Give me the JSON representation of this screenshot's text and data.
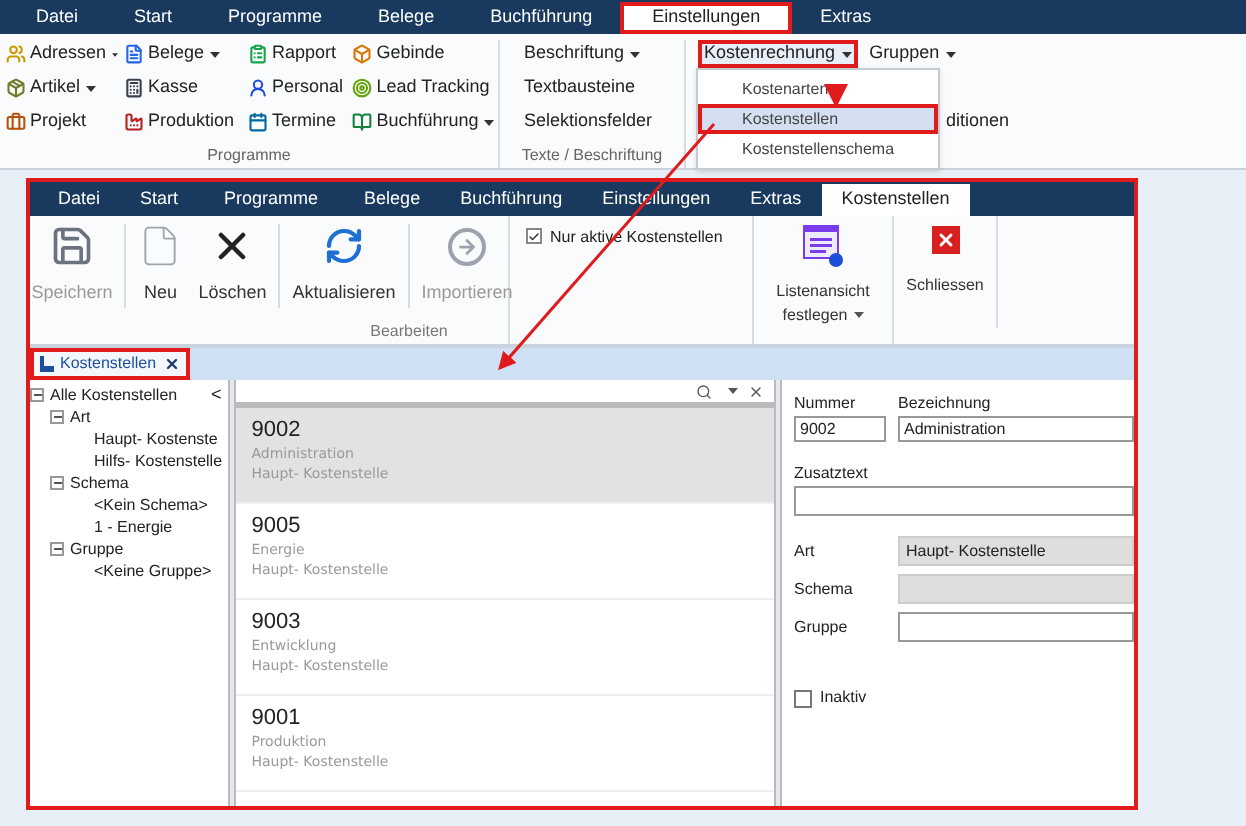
{
  "top_tabs": [
    {
      "label": "Datei",
      "selected": false,
      "highlighted": false
    },
    {
      "label": "Start",
      "selected": false,
      "highlighted": false
    },
    {
      "label": "Programme",
      "selected": false,
      "highlighted": false
    },
    {
      "label": "Belege",
      "selected": false,
      "highlighted": false
    },
    {
      "label": "Buchführung",
      "selected": false,
      "highlighted": false
    },
    {
      "label": "Einstellungen",
      "selected": true,
      "highlighted": true
    },
    {
      "label": "Extras",
      "selected": false,
      "highlighted": false
    }
  ],
  "top_ribbon": {
    "programs_group": {
      "label": "Programme",
      "columns": [
        [
          {
            "label": "Adressen",
            "dropdown": true
          },
          {
            "label": "Artikel",
            "dropdown": true
          },
          {
            "label": "Projekt",
            "dropdown": false
          }
        ],
        [
          {
            "label": "Belege",
            "dropdown": true
          },
          {
            "label": "Kasse",
            "dropdown": false
          },
          {
            "label": "Produktion",
            "dropdown": false
          }
        ],
        [
          {
            "label": "Rapport",
            "dropdown": false
          },
          {
            "label": "Personal",
            "dropdown": false
          },
          {
            "label": "Termine",
            "dropdown": false
          }
        ],
        [
          {
            "label": "Gebinde",
            "dropdown": false
          },
          {
            "label": "Lead Tracking",
            "dropdown": false
          },
          {
            "label": "Buchführung",
            "dropdown": true
          }
        ]
      ]
    },
    "texts_group": {
      "label": "Texte / Beschriftung",
      "items": [
        {
          "label": "Beschriftung",
          "dropdown": true
        },
        {
          "label": "Textbausteine",
          "dropdown": false
        },
        {
          "label": "Selektionsfelder",
          "dropdown": false
        }
      ]
    },
    "cost_group": {
      "items": [
        {
          "label": "Kostenrechnung",
          "dropdown": true,
          "highlighted": true
        },
        {
          "label": "Gruppen",
          "dropdown": true,
          "highlighted": false
        }
      ],
      "partial_item": "ditionen"
    }
  },
  "dropdown_menu": {
    "items": [
      {
        "label": "Kostenarten",
        "selected": false,
        "highlighted": false
      },
      {
        "label": "Kostenstellen",
        "selected": true,
        "highlighted": true
      },
      {
        "label": "Kostenstellenschema",
        "selected": false,
        "highlighted": false
      }
    ]
  },
  "inner_window": {
    "highlighted": true,
    "tabs": [
      {
        "label": "Datei",
        "selected": false
      },
      {
        "label": "Start",
        "selected": false
      },
      {
        "label": "Programme",
        "selected": false
      },
      {
        "label": "Belege",
        "selected": false
      },
      {
        "label": "Buchführung",
        "selected": false
      },
      {
        "label": "Einstellungen",
        "selected": false
      },
      {
        "label": "Extras",
        "selected": false
      },
      {
        "label": "Kostenstellen",
        "selected": true
      }
    ],
    "ribbon": {
      "buttons": [
        {
          "label": "Speichern",
          "disabled": true
        },
        {
          "label": "Neu",
          "disabled": false
        },
        {
          "label": "Löschen",
          "disabled": false
        },
        {
          "label": "Aktualisieren",
          "disabled": false
        },
        {
          "label": "Importieren",
          "disabled": true
        }
      ],
      "group_label": "Bearbeiten",
      "checkbox": {
        "label": "Nur aktive Kostenstellen",
        "checked": true
      },
      "list_view": {
        "lines": [
          "Listenansicht",
          "festlegen"
        ],
        "dropdown": true
      },
      "close": {
        "label": "Schliessen"
      }
    },
    "doc_tab": {
      "label": "Kostenstellen",
      "highlighted": true
    },
    "tree": [
      {
        "label": "Alle Kostenstellen",
        "expanded": true,
        "children": [
          {
            "label": "Art",
            "expanded": true,
            "children": [
              {
                "label": "Haupt- Kostenste"
              },
              {
                "label": "Hilfs- Kostenstelle"
              }
            ]
          },
          {
            "label": "Schema",
            "expanded": true,
            "children": [
              {
                "label": "<Kein Schema>"
              },
              {
                "label": "1 - Energie"
              }
            ]
          },
          {
            "label": "Gruppe",
            "expanded": true,
            "children": [
              {
                "label": "<Keine Gruppe>"
              }
            ]
          }
        ]
      }
    ],
    "tree_collapse": "<",
    "list": [
      {
        "number": "9002",
        "name": "Administration",
        "type": "Haupt- Kostenstelle",
        "selected": true
      },
      {
        "number": "9005",
        "name": "Energie",
        "type": "Haupt- Kostenstelle",
        "selected": false
      },
      {
        "number": "9003",
        "name": "Entwicklung",
        "type": "Haupt- Kostenstelle",
        "selected": false
      },
      {
        "number": "9001",
        "name": "Produktion",
        "type": "Haupt- Kostenstelle",
        "selected": false
      }
    ],
    "detail": {
      "number": {
        "label": "Nummer",
        "value": "9002"
      },
      "designation": {
        "label": "Bezeichnung",
        "value": "Administration"
      },
      "extra_text": {
        "label": "Zusatztext"
      },
      "fields": [
        {
          "label": "Art",
          "value": "Haupt- Kostenstelle",
          "disabled": true
        },
        {
          "label": "Schema",
          "disabled": true
        },
        {
          "label": "Gruppe",
          "disabled": false
        }
      ],
      "inactive": {
        "label": "Inaktiv",
        "checked": false
      }
    }
  }
}
